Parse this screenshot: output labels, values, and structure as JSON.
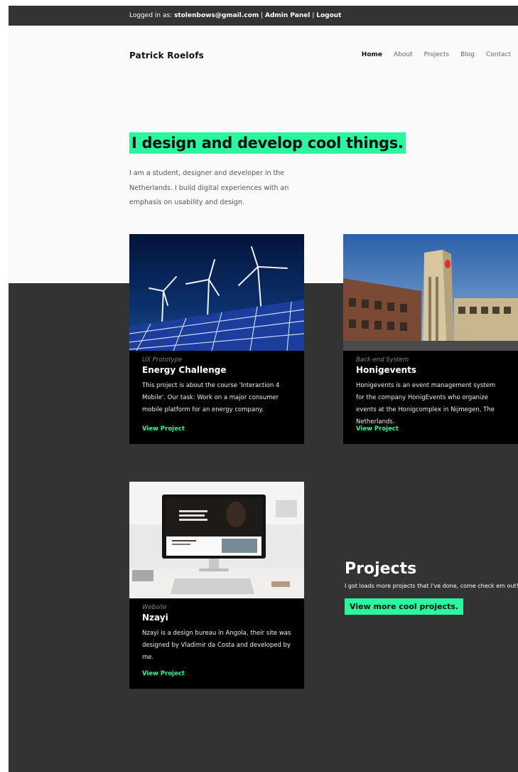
{
  "admin_bar": {
    "logged_in_label": "Logged in as:",
    "email": "stolenbows@gmail.com",
    "separator": "|",
    "admin_panel": "Admin Panel",
    "logout": "Logout"
  },
  "header": {
    "logo": "Patrick Roelofs",
    "nav": [
      "Home",
      "About",
      "Projects",
      "Blog",
      "Contact"
    ],
    "active_nav": "Home"
  },
  "hero": {
    "headline": "I design and develop cool things.",
    "intro": "I am a student, designer and developer in the Netherlands. I build digital experiences with an emphasis on usability and design."
  },
  "projects": [
    {
      "type": "UX Prototype",
      "title": "Energy Challenge",
      "description": "This project is about the course 'Interaction 4 Mobile'. Our task: Work on a major consumer mobile platform for an energy company.",
      "link": "View Project"
    },
    {
      "type": "Back-end System",
      "title": "Honigevents",
      "description": "Honigevents is an event management system for the company HonigEvents who organize events at the Honigcomplex in Nijmegen, The Netherlands.",
      "link": "View Project"
    },
    {
      "type": "Website",
      "title": "Nzayi",
      "description": "Nzayi is a design bureau in Angola, their site was designed by Vladimir da Costa and developed by me.",
      "link": "View Project"
    }
  ],
  "projects_section": {
    "title": "Projects",
    "subtitle": "I got loads more projects that I've done, come check em out!",
    "button": "View more cool projects."
  },
  "colors": {
    "accent": "#2cf59f",
    "dark": "#333333",
    "card": "#000000",
    "light": "#fafafa"
  }
}
